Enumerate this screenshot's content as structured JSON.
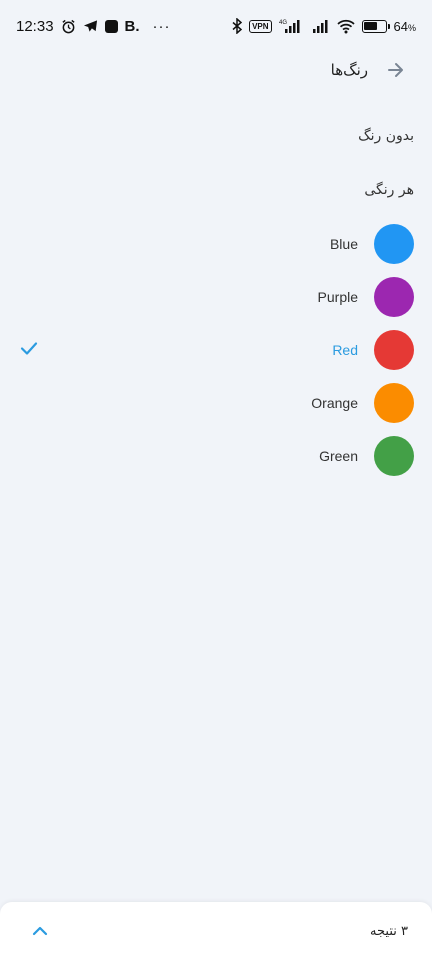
{
  "status_bar": {
    "time": "12:33",
    "app_letter": "B.",
    "more_dots": "···",
    "vpn": "VPN",
    "network": "4G",
    "battery_level": 0.64,
    "battery_text": "64",
    "battery_unit": "%"
  },
  "header": {
    "title": "رنگ‌ها",
    "back_icon": "arrow-right-icon"
  },
  "options": {
    "no_color": "بدون رنگ",
    "any_color": "هر رنگی"
  },
  "colors": [
    {
      "name": "Blue",
      "hex": "#2196f3",
      "selected": false
    },
    {
      "name": "Purple",
      "hex": "#9c27b0",
      "selected": false
    },
    {
      "name": "Red",
      "hex": "#e53935",
      "selected": true
    },
    {
      "name": "Orange",
      "hex": "#fb8c00",
      "selected": false
    },
    {
      "name": "Green",
      "hex": "#43a047",
      "selected": false
    }
  ],
  "accent_color": "#2b9be0",
  "bottom_bar": {
    "result_count": "۳ نتیجه",
    "expand_icon": "chevron-up-icon"
  }
}
